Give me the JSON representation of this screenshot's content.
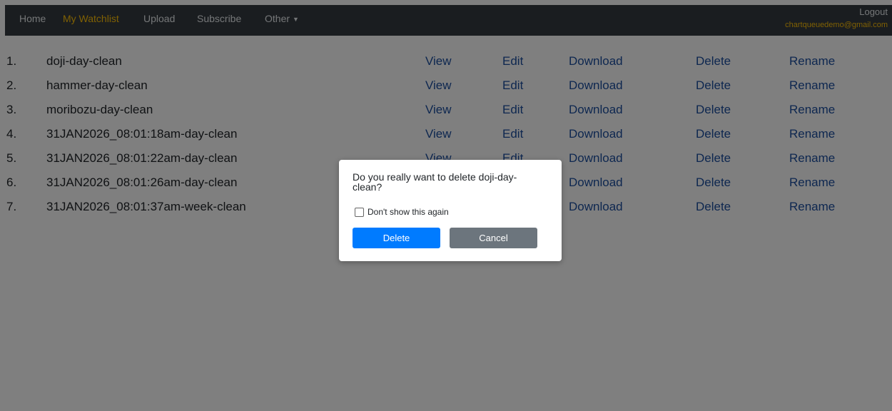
{
  "nav": {
    "home": "Home",
    "watchlist": "My Watchlist",
    "upload": "Upload",
    "subscribe": "Subscribe",
    "other": "Other",
    "other_caret": "▼",
    "logout": "Logout",
    "email": "chartqueuedemo@gmail.com"
  },
  "actions": {
    "view": "View",
    "edit": "Edit",
    "download": "Download",
    "delete": "Delete",
    "rename": "Rename"
  },
  "items": [
    {
      "num": "1.",
      "name": "doji-day-clean"
    },
    {
      "num": "2.",
      "name": "hammer-day-clean"
    },
    {
      "num": "3.",
      "name": "moribozu-day-clean"
    },
    {
      "num": "4.",
      "name": "31JAN2026_08:01:18am-day-clean"
    },
    {
      "num": "5.",
      "name": "31JAN2026_08:01:22am-day-clean"
    },
    {
      "num": "6.",
      "name": "31JAN2026_08:01:26am-day-clean"
    },
    {
      "num": "7.",
      "name": "31JAN2026_08:01:37am-week-clean"
    }
  ],
  "dialog": {
    "message": "Do you really want to delete doji-day-clean?",
    "checkbox_label": "Don't show this again",
    "checkbox_checked": false,
    "delete_label": "Delete",
    "cancel_label": "Cancel"
  },
  "colors": {
    "navbar": "#343a40",
    "active": "#ffc107",
    "link": "#1c4fa0",
    "primary": "#007bff",
    "secondary": "#6c757d"
  }
}
